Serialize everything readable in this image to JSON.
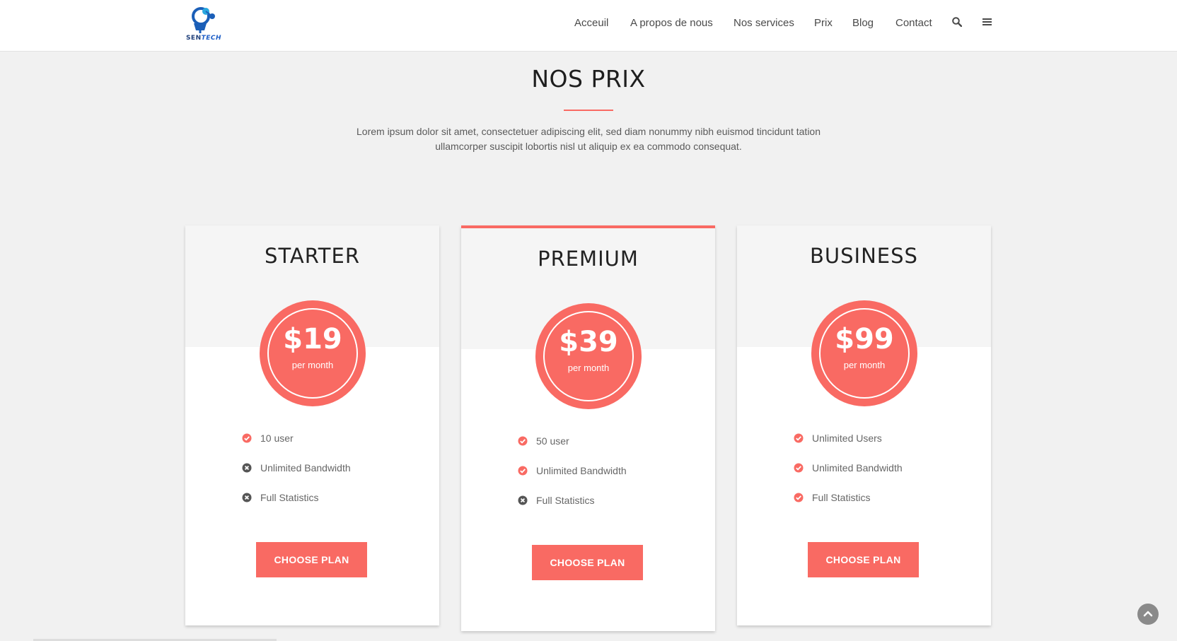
{
  "brand": {
    "logo_text_a": "SEN",
    "logo_text_b": "TECH"
  },
  "nav": {
    "items": [
      "Acceuil",
      "A propos de nous",
      "Nos services",
      "Prix",
      "Blog",
      "Contact"
    ],
    "search_icon": "search-icon",
    "menu_icon": "hamburger-menu-icon"
  },
  "section": {
    "title": "NOS PRIX",
    "description": "Lorem ipsum dolor sit amet, consectetuer adipiscing elit, sed diam nonummy nibh euismod tincidunt tation ullamcorper suscipit lobortis nisl ut aliquip ex ea commodo consequat."
  },
  "colors": {
    "accent": "#f96a63",
    "check": "#f96a63",
    "cross": "#555555"
  },
  "plans": [
    {
      "name": "STARTER",
      "price": "$19",
      "period": "per month",
      "features": [
        {
          "label": "10 user",
          "included": true
        },
        {
          "label": "Unlimited Bandwidth",
          "included": false
        },
        {
          "label": "Full Statistics",
          "included": false
        }
      ],
      "button": "CHOOSE PLAN"
    },
    {
      "name": "PREMIUM",
      "price": "$39",
      "period": "per month",
      "featured": true,
      "features": [
        {
          "label": "50 user",
          "included": true
        },
        {
          "label": "Unlimited Bandwidth",
          "included": true
        },
        {
          "label": "Full Statistics",
          "included": false
        }
      ],
      "button": "CHOOSE PLAN"
    },
    {
      "name": "BUSINESS",
      "price": "$99",
      "period": "per month",
      "features": [
        {
          "label": "Unlimited Users",
          "included": true
        },
        {
          "label": "Unlimited Bandwidth",
          "included": true
        },
        {
          "label": "Full Statistics",
          "included": true
        }
      ],
      "button": "CHOOSE PLAN"
    }
  ],
  "scroll_top_icon": "chevron-up-icon"
}
